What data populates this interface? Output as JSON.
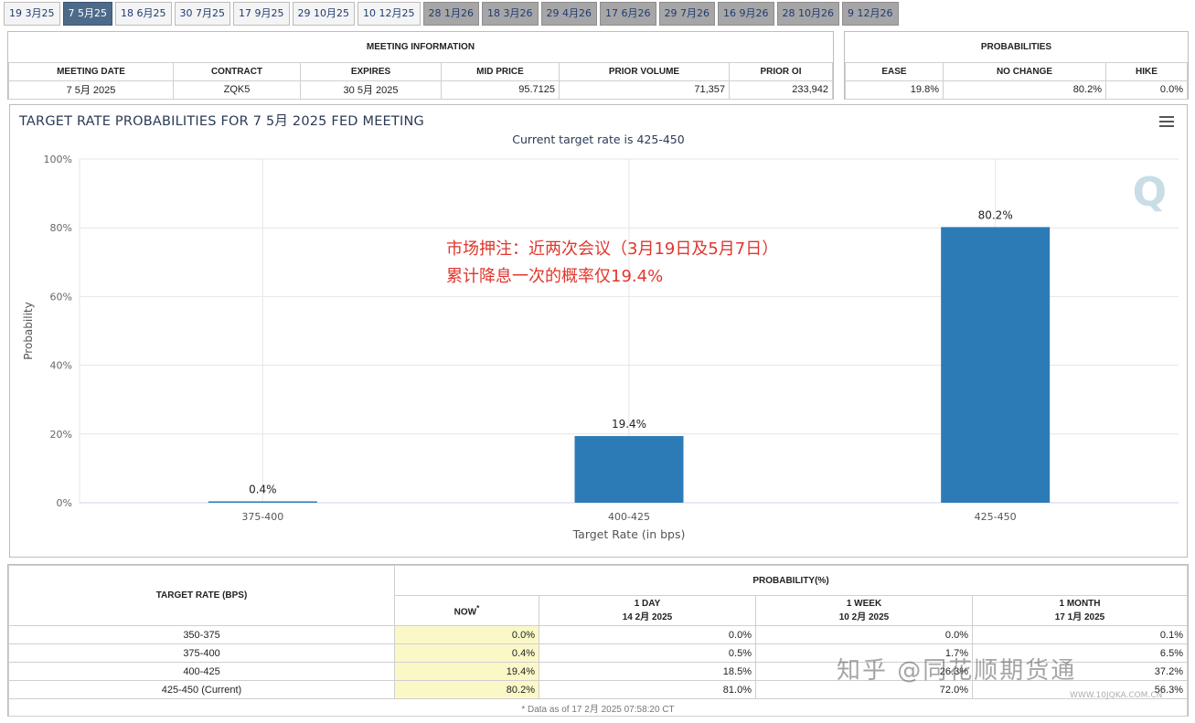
{
  "tabs": [
    {
      "label": "19 3月25",
      "state": "past"
    },
    {
      "label": "7 5月25",
      "state": "active"
    },
    {
      "label": "18 6月25",
      "state": "past"
    },
    {
      "label": "30 7月25",
      "state": "past"
    },
    {
      "label": "17 9月25",
      "state": "past"
    },
    {
      "label": "29 10月25",
      "state": "past"
    },
    {
      "label": "10 12月25",
      "state": "past"
    },
    {
      "label": "28 1月26",
      "state": "future"
    },
    {
      "label": "18 3月26",
      "state": "future"
    },
    {
      "label": "29 4月26",
      "state": "future"
    },
    {
      "label": "17 6月26",
      "state": "future"
    },
    {
      "label": "29 7月26",
      "state": "future"
    },
    {
      "label": "16 9月26",
      "state": "future"
    },
    {
      "label": "28 10月26",
      "state": "future"
    },
    {
      "label": "9 12月26",
      "state": "future"
    }
  ],
  "meeting_info": {
    "title": "MEETING INFORMATION",
    "headers": [
      "MEETING DATE",
      "CONTRACT",
      "EXPIRES",
      "MID PRICE",
      "PRIOR VOLUME",
      "PRIOR OI"
    ],
    "row": [
      "7 5月 2025",
      "ZQK5",
      "30 5月 2025",
      "95.7125",
      "71,357",
      "233,942"
    ]
  },
  "probabilities": {
    "title": "PROBABILITIES",
    "headers": [
      "EASE",
      "NO CHANGE",
      "HIKE"
    ],
    "row": [
      "19.8%",
      "80.2%",
      "0.0%"
    ]
  },
  "chart_data": {
    "type": "bar",
    "title": "TARGET RATE PROBABILITIES FOR 7 5月 2025 FED MEETING",
    "subtitle": "Current target rate is 425-450",
    "categories": [
      "375-400",
      "400-425",
      "425-450"
    ],
    "values": [
      0.4,
      19.4,
      80.2
    ],
    "value_labels": [
      "0.4%",
      "19.4%",
      "80.2%"
    ],
    "xlabel": "Target Rate (in bps)",
    "ylabel": "Probability",
    "ylim": [
      0,
      100
    ],
    "yticks": [
      "0%",
      "20%",
      "40%",
      "60%",
      "80%",
      "100%"
    ],
    "bar_color": "#2d7bb6",
    "grid": true
  },
  "annotation": {
    "line1": "市场押注：近两次会议（3月19日及5月7日）",
    "line2": "累计降息一次的概率仅19.4%",
    "color": "#e0362c"
  },
  "prob_table": {
    "rate_header": "TARGET RATE (BPS)",
    "prob_header": "PROBABILITY(%)",
    "columns": [
      {
        "line1": "NOW",
        "line2": "",
        "marker": "*"
      },
      {
        "line1": "1 DAY",
        "line2": "14 2月 2025"
      },
      {
        "line1": "1 WEEK",
        "line2": "10 2月 2025"
      },
      {
        "line1": "1 MONTH",
        "line2": "17 1月 2025"
      }
    ],
    "rows": [
      {
        "rate": "350-375",
        "values": [
          "0.0%",
          "0.0%",
          "0.0%",
          "0.1%"
        ]
      },
      {
        "rate": "375-400",
        "values": [
          "0.4%",
          "0.5%",
          "1.7%",
          "6.5%"
        ]
      },
      {
        "rate": "400-425",
        "values": [
          "19.4%",
          "18.5%",
          "26.3%",
          "37.2%"
        ]
      },
      {
        "rate": "425-450 (Current)",
        "values": [
          "80.2%",
          "81.0%",
          "72.0%",
          "56.3%"
        ]
      }
    ],
    "footnote": "* Data as of 17 2月 2025 07:58:20 CT"
  },
  "watermark": {
    "text": "知乎 @同花顺期货通",
    "sub": "WWW.10JQKA.COM.CN"
  }
}
